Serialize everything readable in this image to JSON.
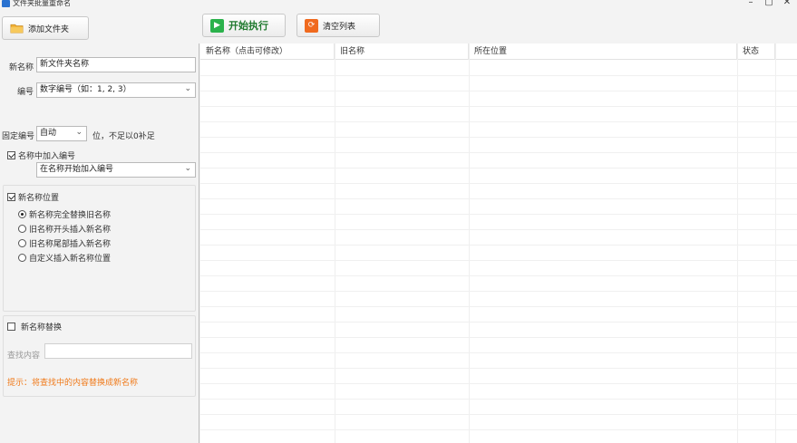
{
  "window": {
    "title": "文件夹批量重命名",
    "min": "–",
    "max": "▢",
    "close": "✕"
  },
  "toolbar": {
    "add_folder": "添加文件夹",
    "start": "开始执行",
    "clear": "清空列表"
  },
  "form": {
    "new_name_label": "新名称",
    "new_name_value": "新文件夹名称",
    "number_label": "编号",
    "number_value": "数字编号（如：1, 2, 3）",
    "fixed_label": "固定编号",
    "fixed_value": "自动",
    "fixed_suffix": "位，不足以0补足",
    "add_number_label": "名称中加入编号",
    "add_number_value": "在名称开始加入编号",
    "position_group_label": "新名称位置",
    "position_options": [
      "新名称完全替换旧名称",
      "旧名称开头插入新名称",
      "旧名称尾部插入新名称",
      "自定义插入新名称位置"
    ],
    "replace_label": "新名称替换",
    "search_label": "查找内容",
    "hint": "提示：将查找中的内容替换成新名称"
  },
  "table": {
    "columns": [
      "新名称（点击可修改）",
      "旧名称",
      "所在位置",
      "状态"
    ]
  },
  "colors": {
    "start_icon": "#2bb24c",
    "clear_icon": "#f06a1e",
    "hint": "#f07a1a",
    "folder_icon": "#f2b43a"
  }
}
